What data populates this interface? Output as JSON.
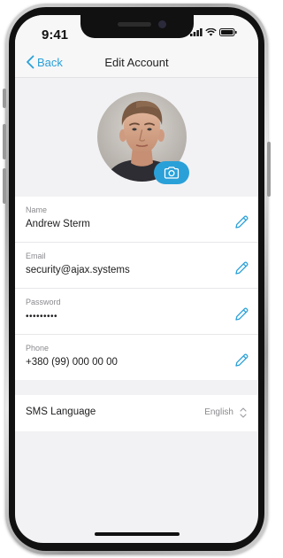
{
  "status_bar": {
    "time": "9:41",
    "icons": [
      "signal-icon",
      "wifi-icon",
      "battery-icon"
    ]
  },
  "nav": {
    "back_label": "Back",
    "title": "Edit Account"
  },
  "profile": {
    "camera_icon": "camera-icon"
  },
  "fields": [
    {
      "label": "Name",
      "value": "Andrew Sterm",
      "action_icon": "pencil-icon"
    },
    {
      "label": "Email",
      "value": "security@ajax.systems",
      "action_icon": "pencil-icon"
    },
    {
      "label": "Password",
      "value": "•••••••••",
      "action_icon": "pencil-icon"
    },
    {
      "label": "Phone",
      "value": "+380 (99) 000 00 00",
      "action_icon": "pencil-icon"
    }
  ],
  "sms_language": {
    "label": "SMS Language",
    "value": "English",
    "icon": "up-down-chevron-icon"
  },
  "colors": {
    "accent": "#2aa0d8",
    "background": "#f2f2f4",
    "card": "#ffffff"
  }
}
